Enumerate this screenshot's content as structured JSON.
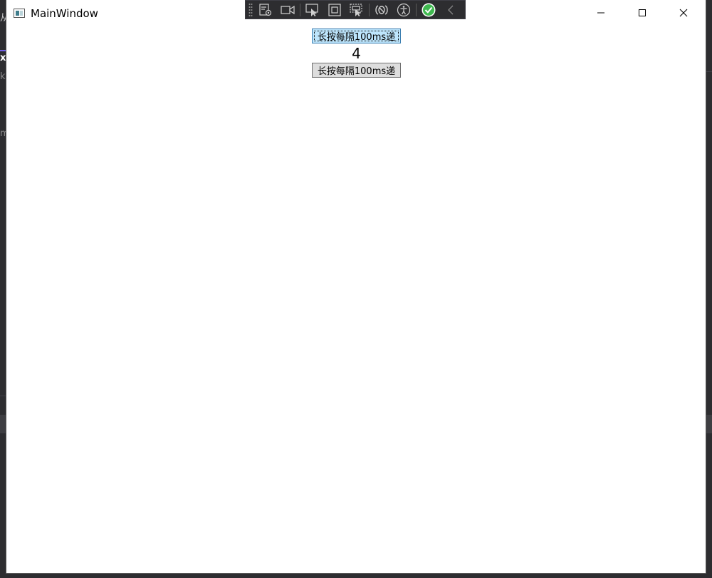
{
  "window": {
    "title": "MainWindow",
    "icon": "app-window-icon"
  },
  "caption_buttons": [
    {
      "name": "minimize",
      "icon": "minimize-icon"
    },
    {
      "name": "maximize",
      "icon": "maximize-icon"
    },
    {
      "name": "close",
      "icon": "close-icon"
    }
  ],
  "debug_toolbar": {
    "items": [
      {
        "name": "go-to-live-visual-tree",
        "icon": "live-visual-tree-icon"
      },
      {
        "name": "in-app-selection-record",
        "icon": "video-camera-icon"
      },
      {
        "name": "select-element",
        "icon": "select-element-icon"
      },
      {
        "name": "display-layout-adorners",
        "icon": "layout-adorner-icon"
      },
      {
        "name": "track-focused-element",
        "icon": "track-focus-icon"
      },
      {
        "name": "binding-failures",
        "icon": "binding-icon"
      },
      {
        "name": "accessibility-checker",
        "icon": "accessibility-icon"
      },
      {
        "name": "status-ok",
        "icon": "checkmark-circle-icon"
      },
      {
        "name": "collapse-toolbar",
        "icon": "chevron-left-icon"
      }
    ]
  },
  "content": {
    "top_button_label": "长按每隔100ms递",
    "counter_value": "4",
    "bottom_button_label": "长按每隔100ms递"
  },
  "background": {
    "fragment_1": "从",
    "fragment_2": "x",
    "fragment_3": "ka",
    "fragment_4": "m"
  },
  "colors": {
    "focused_button_bg": "#bee6fd",
    "focused_button_border": "#3c7fb1",
    "button_bg": "#dddddd",
    "toolbar_bg": "#2d2d30",
    "status_ok": "#3fb950"
  }
}
